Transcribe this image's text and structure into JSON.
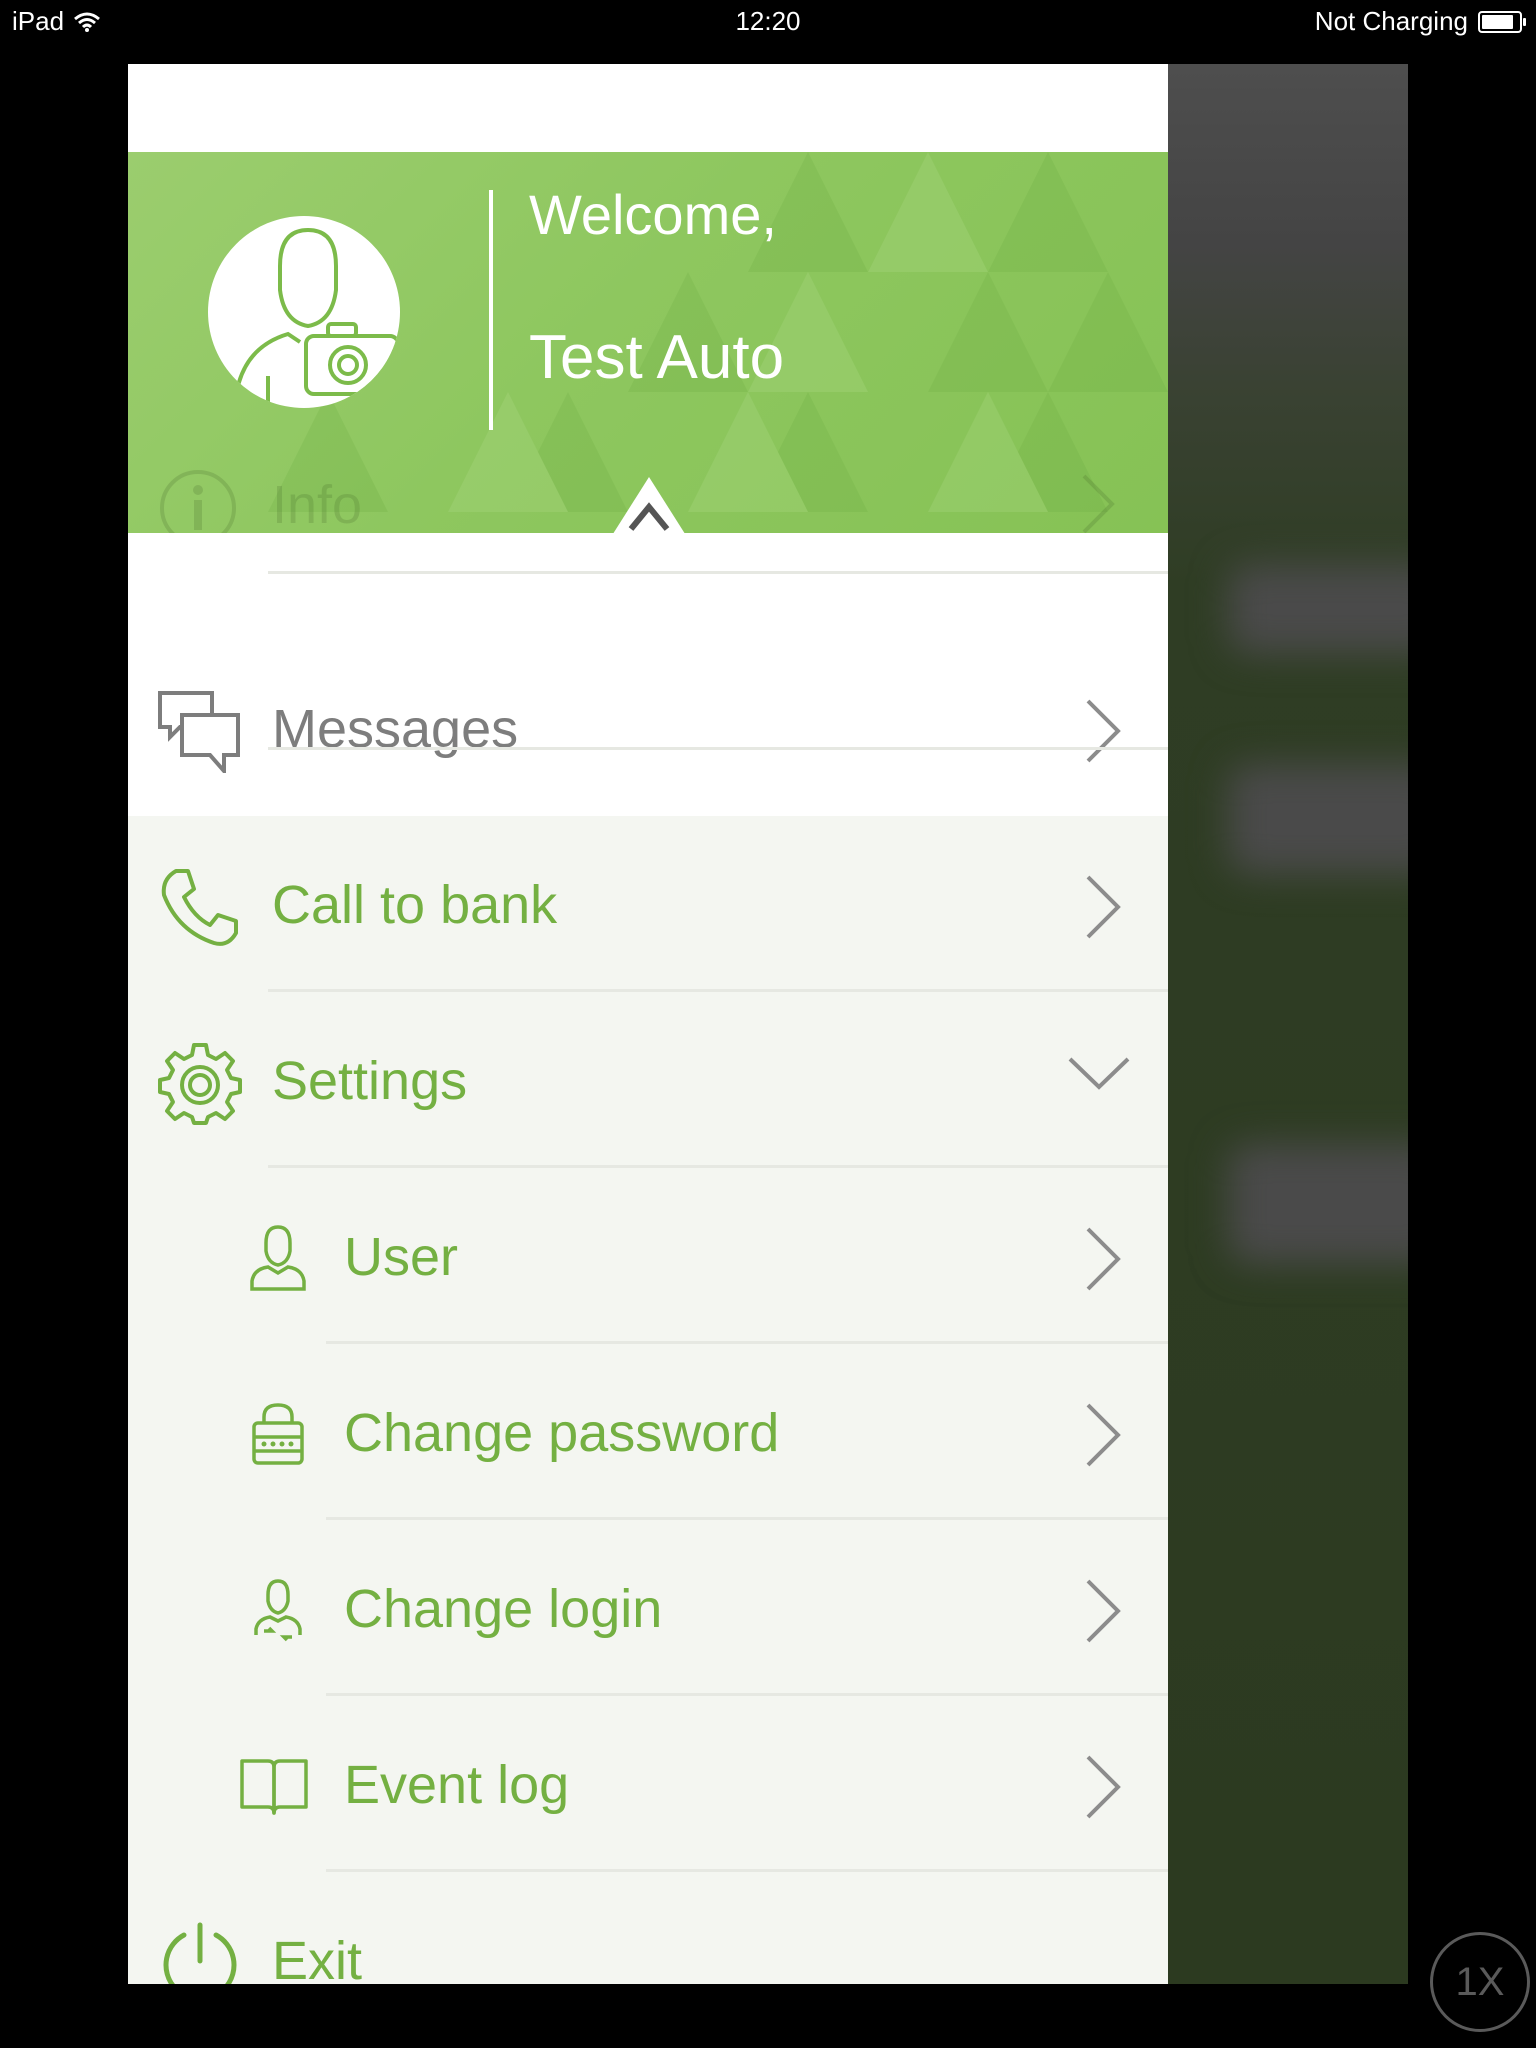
{
  "status_bar": {
    "device": "iPad",
    "time": "12:20",
    "charging": "Not Charging",
    "battery_level": 0.85
  },
  "header": {
    "welcome": "Welcome,",
    "username": "Test Auto",
    "partially_hidden_item": "Info"
  },
  "menu": {
    "messages": "Messages",
    "call_to_bank": "Call to bank",
    "settings": "Settings",
    "user": "User",
    "change_password": "Change password",
    "change_login": "Change login",
    "event_log": "Event log",
    "exit": "Exit"
  },
  "icons": {
    "avatar": "user-camera-icon",
    "info": "info-icon",
    "messages": "chat-bubbles-icon",
    "call": "phone-icon",
    "settings": "gear-icon",
    "user": "user-icon",
    "password": "lock-icon",
    "login": "user-swap-icon",
    "event_log": "book-icon",
    "exit": "power-icon"
  },
  "colors": {
    "accent": "#74b042",
    "header": "#8ec75f",
    "gray_text": "#7d7d7d"
  },
  "overlay_badge": "1X"
}
